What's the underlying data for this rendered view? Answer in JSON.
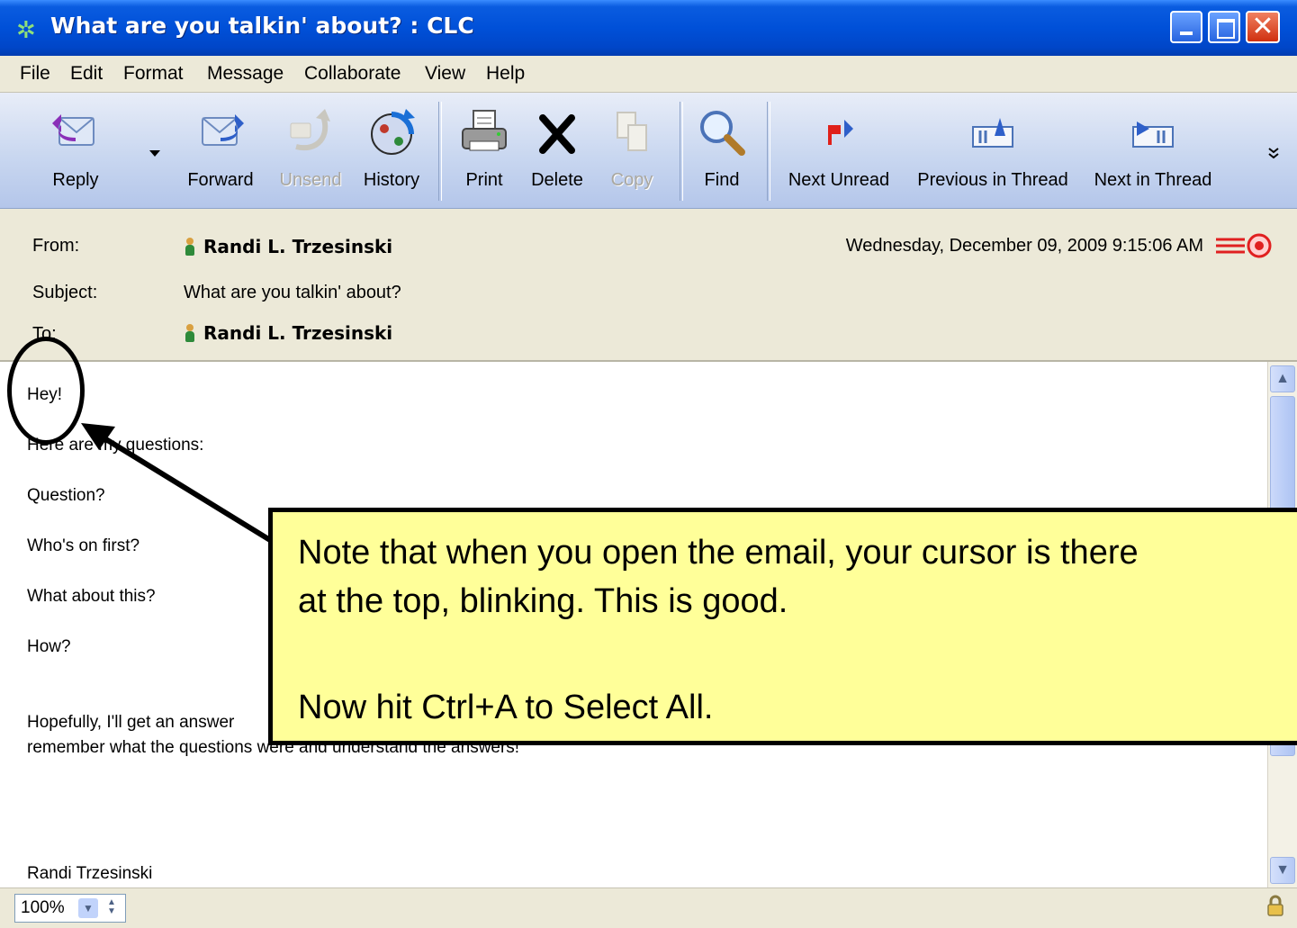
{
  "window": {
    "title": "What are you talkin' about? : CLC",
    "colors": {
      "titlebar": "#0050d8",
      "callout_bg": "#ffff99"
    }
  },
  "menu": [
    "File",
    "Edit",
    "Format",
    "Message",
    "Collaborate",
    "View",
    "Help"
  ],
  "toolbar": {
    "buttons": [
      {
        "label": "Reply",
        "icon": "reply-icon",
        "enabled": true
      },
      {
        "label": "Forward",
        "icon": "forward-icon",
        "enabled": true
      },
      {
        "label": "Unsend",
        "icon": "unsend-icon",
        "enabled": false
      },
      {
        "label": "History",
        "icon": "history-icon",
        "enabled": true
      },
      {
        "label": "Print",
        "icon": "printer-icon",
        "enabled": true
      },
      {
        "label": "Delete",
        "icon": "delete-x-icon",
        "enabled": true
      },
      {
        "label": "Copy",
        "icon": "copy-icon",
        "enabled": false
      },
      {
        "label": "Find",
        "icon": "magnifier-icon",
        "enabled": true
      },
      {
        "label": "Next Unread",
        "icon": "next-unread-flag-icon",
        "enabled": true
      },
      {
        "label": "Previous in Thread",
        "icon": "previous-thread-icon",
        "enabled": true
      },
      {
        "label": "Next in Thread",
        "icon": "next-thread-icon",
        "enabled": true
      }
    ]
  },
  "header": {
    "from_label": "From:",
    "from_value": "Randi L. Trzesinski",
    "subject_label": "Subject:",
    "subject_value": "What are you talkin' about?",
    "to_label": "To:",
    "to_value": "Randi L. Trzesinski",
    "date": "Wednesday, December 09, 2009 9:15:06 AM"
  },
  "body": {
    "lines": [
      "Hey!",
      "Here are my questions:",
      "Question?",
      "Who's on first?",
      "What about this?",
      "How?",
      "Hopefully, I'll get an answer",
      "remember what the questions were and understand the answers!",
      "Randi Trzesinski"
    ]
  },
  "status": {
    "zoom": "100%"
  },
  "callout": {
    "line1": "Note that when you open the email, your cursor is there",
    "line2": "at the top, blinking. This is good.",
    "line3": "Now hit Ctrl+A to Select All."
  }
}
